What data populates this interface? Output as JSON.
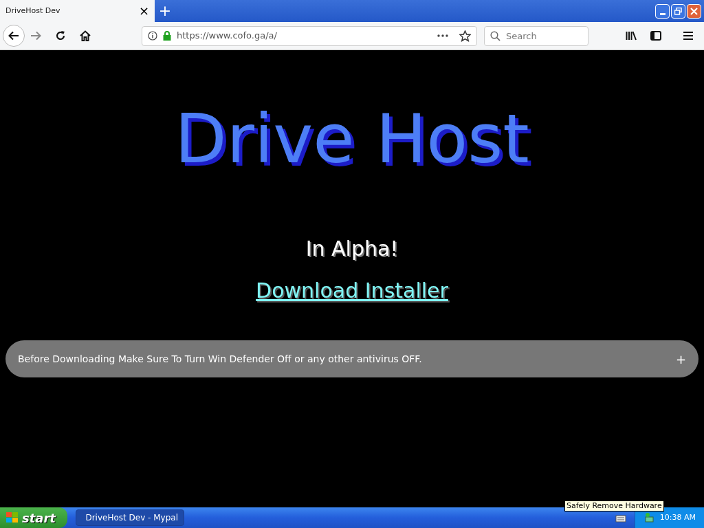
{
  "browser": {
    "tab": {
      "title": "DriveHost Dev",
      "close": "×",
      "selected": true
    },
    "new_tab": "+",
    "url": "https://www.cofo.ga/a/",
    "search": {
      "placeholder": "Search"
    }
  },
  "page": {
    "title": "Drive Host",
    "subtitle": "In Alpha!",
    "link": "Download Installer",
    "notice": {
      "text": "Before Downloading Make Sure To Turn Win Defender Off or any other antivirus OFF.",
      "toggle": "+",
      "expanded": false
    }
  },
  "taskbar": {
    "start": "start",
    "tasks": [
      {
        "label": "DriveHost Dev - Mypal",
        "selected": true
      }
    ],
    "tooltip": "Safely Remove Hardware",
    "clock": "10:38 AM"
  }
}
